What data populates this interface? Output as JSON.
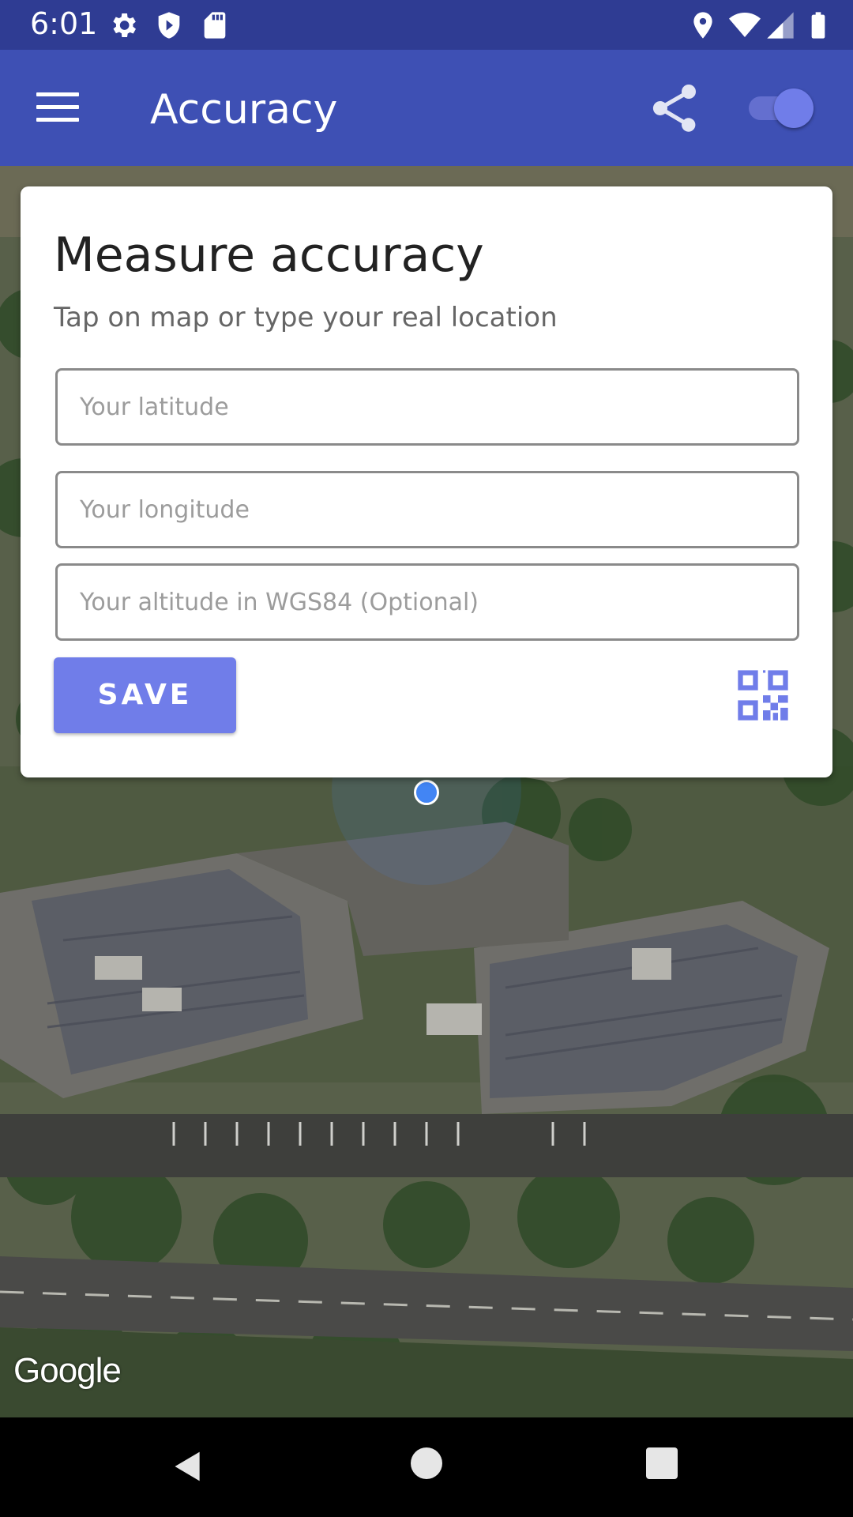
{
  "status_bar": {
    "time": "6:01",
    "icons": [
      "settings-icon",
      "shield-icon",
      "sd-card-icon",
      "location-icon",
      "wifi-icon",
      "signal-icon",
      "battery-icon"
    ]
  },
  "app_bar": {
    "title": "Accuracy",
    "menu_icon": "hamburger-menu-icon",
    "share_icon": "share-icon",
    "toggle_on": true,
    "color": "#3e50b4"
  },
  "card": {
    "title": "Measure accuracy",
    "subtitle": "Tap on map or type your real location",
    "fields": {
      "latitude_placeholder": "Your latitude",
      "longitude_placeholder": "Your longitude",
      "altitude_placeholder": "Your altitude in WGS84 (Optional)"
    },
    "save_label": "SAVE",
    "qr_icon": "qr-code-icon",
    "accent": "#707de9"
  },
  "map": {
    "attribution": "Google",
    "type": "satellite"
  },
  "nav_bar": {
    "icons": [
      "back-icon",
      "home-icon",
      "recents-icon"
    ]
  }
}
